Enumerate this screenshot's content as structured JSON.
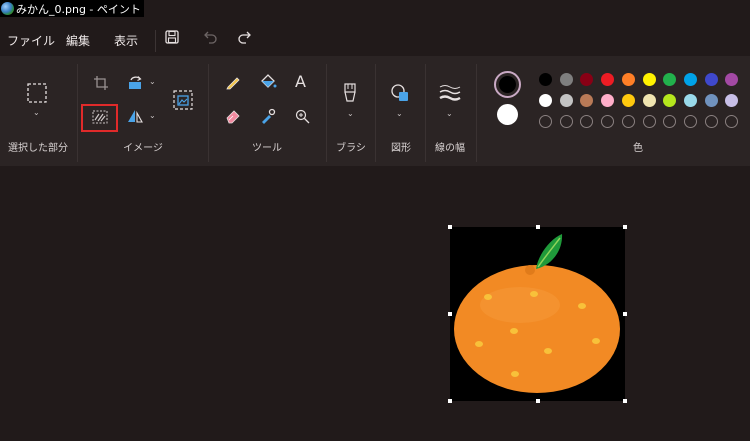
{
  "window": {
    "title": "みかん_0.png - ペイント"
  },
  "menu": {
    "file": "ファイル",
    "edit": "編集",
    "view": "表示"
  },
  "icons": {
    "save": "save-icon",
    "undo": "undo-icon",
    "redo": "redo-icon",
    "select": "rect-select-icon",
    "crop": "crop-icon",
    "rotate": "rotate-icon",
    "transparency": "transparent-select-icon",
    "flip": "flip-icon",
    "resize": "resize-icon",
    "pencil": "pencil-icon",
    "fill": "fill-icon",
    "text": "text-icon",
    "eraser": "eraser-icon",
    "picker": "color-picker-icon",
    "zoom": "magnifier-icon",
    "brush": "brush-icon",
    "shapes": "shapes-icon",
    "line_width": "line-width-icon"
  },
  "ribbon": {
    "selection_label": "選択した部分",
    "image_label": "イメージ",
    "tools_label": "ツール",
    "brush_label": "ブラシ",
    "shapes_label": "図形",
    "width_label": "線の幅",
    "colors_label": "色",
    "text_tool_glyph": "A"
  },
  "colors": {
    "primary": "#000000",
    "secondary": "#ffffff",
    "row1": [
      "#000000",
      "#7f7f7f",
      "#880015",
      "#ed1c24",
      "#ff7f27",
      "#fff200",
      "#22b14c",
      "#00a2e8",
      "#3f48cc",
      "#a349a4"
    ],
    "row2": [
      "#ffffff",
      "#c3c3c3",
      "#b97a57",
      "#ffaec9",
      "#ffc90e",
      "#efe4b0",
      "#b5e61d",
      "#99d9ea",
      "#7092be",
      "#c8bfe7"
    ],
    "row3_count": 10
  },
  "highlight_color": "#e02a2a"
}
